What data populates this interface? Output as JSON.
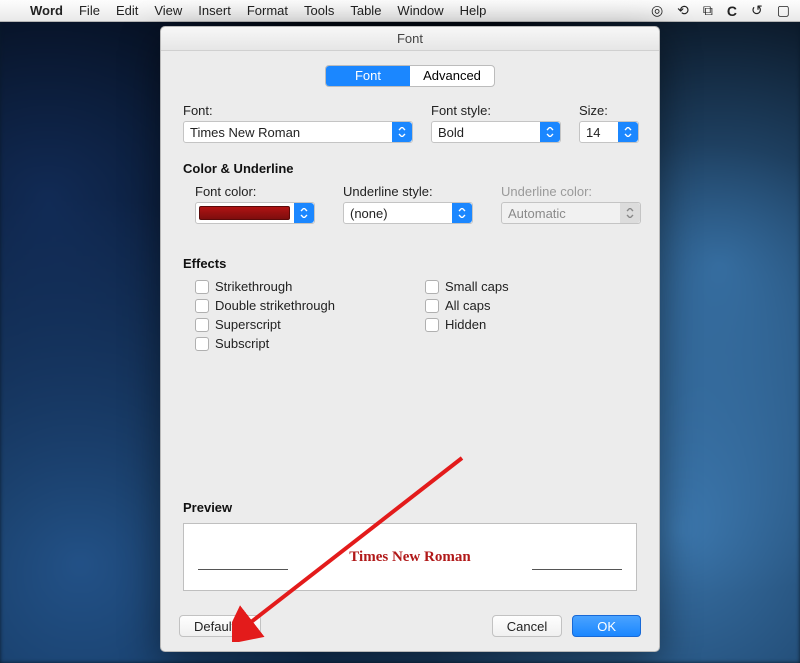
{
  "menubar": {
    "app": "Word",
    "items": [
      "File",
      "Edit",
      "View",
      "Insert",
      "Format",
      "Tools",
      "Table",
      "Window",
      "Help"
    ]
  },
  "dialog": {
    "title": "Font",
    "tabs": {
      "font": "Font",
      "advanced": "Advanced"
    },
    "font_section": {
      "font_label": "Font:",
      "font_value": "Times New Roman",
      "style_label": "Font style:",
      "style_value": "Bold",
      "size_label": "Size:",
      "size_value": "14"
    },
    "color_section": {
      "heading": "Color & Underline",
      "font_color_label": "Font color:",
      "underline_style_label": "Underline style:",
      "underline_style_value": "(none)",
      "underline_color_label": "Underline color:",
      "underline_color_value": "Automatic"
    },
    "effects": {
      "heading": "Effects",
      "left": [
        "Strikethrough",
        "Double strikethrough",
        "Superscript",
        "Subscript"
      ],
      "right": [
        "Small caps",
        "All caps",
        "Hidden"
      ]
    },
    "preview": {
      "heading": "Preview",
      "text": "Times New Roman"
    },
    "buttons": {
      "default": "Default...",
      "cancel": "Cancel",
      "ok": "OK"
    }
  }
}
